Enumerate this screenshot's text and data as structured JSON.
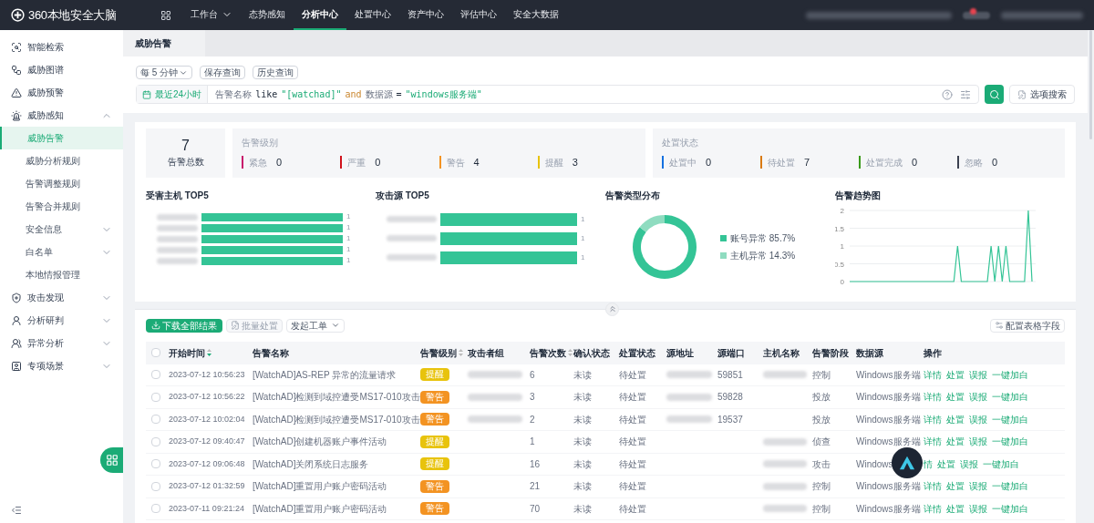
{
  "topbar": {
    "logo": "360本地安全大脑",
    "menu": [
      {
        "label": "工作台",
        "kind": "dropdown",
        "selected": false
      },
      {
        "label": "态势感知",
        "kind": "link",
        "selected": false
      },
      {
        "label": "分析中心",
        "kind": "link",
        "selected": true
      },
      {
        "label": "处置中心",
        "kind": "link",
        "selected": false
      },
      {
        "label": "资产中心",
        "kind": "link",
        "selected": false
      },
      {
        "label": "评估中心",
        "kind": "link",
        "selected": false
      },
      {
        "label": "安全大数据",
        "kind": "link",
        "selected": false
      }
    ]
  },
  "sidebar": {
    "items": [
      {
        "label": "智能检索",
        "selected": false
      },
      {
        "label": "威胁图谱",
        "selected": false
      },
      {
        "label": "威胁预警",
        "selected": false
      },
      {
        "label": "威胁感知",
        "selected": false,
        "expanded": true,
        "children": [
          {
            "label": "威胁告警",
            "selected": true
          },
          {
            "label": "威胁分析规则",
            "selected": false
          },
          {
            "label": "告警调整规则",
            "selected": false
          },
          {
            "label": "告警合并规则",
            "selected": false
          },
          {
            "label": "安全信息",
            "selected": false,
            "expanded": false
          },
          {
            "label": "白名单",
            "selected": false,
            "expanded": false
          },
          {
            "label": "本地情报管理",
            "selected": false
          }
        ]
      },
      {
        "label": "攻击发现",
        "selected": false,
        "expanded": false
      },
      {
        "label": "分析研判",
        "selected": false,
        "expanded": false
      },
      {
        "label": "异常分析",
        "selected": false,
        "expanded": false
      },
      {
        "label": "专项场景",
        "selected": false,
        "expanded": false
      }
    ]
  },
  "page_tab": "威胁告警",
  "query": {
    "interval": "每 5 分钟",
    "buttons": [
      "保存查询",
      "历史查询"
    ],
    "time_range": "最近24小时",
    "tokens": [
      {
        "text": "告警名称",
        "kind": "field"
      },
      {
        "text": "like",
        "kind": "op"
      },
      {
        "text": "\"[watchad]\"",
        "kind": "string"
      },
      {
        "text": "and",
        "kind": "keyword"
      },
      {
        "text": "数据源",
        "kind": "field"
      },
      {
        "text": "=",
        "kind": "op"
      },
      {
        "text": "\"windows服务端\"",
        "kind": "string"
      }
    ],
    "option_search": "选项搜索"
  },
  "summary": {
    "total": "7",
    "total_label": "告警总数",
    "levels": {
      "title": "告警级别",
      "items": [
        {
          "label": "紧急",
          "count": "0",
          "color": "#c8166b"
        },
        {
          "label": "严重",
          "count": "0",
          "color": "#d0121b"
        },
        {
          "label": "警告",
          "count": "4",
          "color": "#f39322"
        },
        {
          "label": "提醒",
          "count": "3",
          "color": "#e8c30c"
        }
      ]
    },
    "statuses": {
      "title": "处置状态",
      "items": [
        {
          "label": "处置中",
          "count": "0",
          "color": "#1470e0"
        },
        {
          "label": "待处置",
          "count": "7",
          "color": "#d97a12"
        },
        {
          "label": "处置完成",
          "count": "0",
          "color": "#3a9a1a"
        },
        {
          "label": "忽略",
          "count": "0",
          "color": "#3b4150"
        }
      ]
    }
  },
  "charts": [
    {
      "title": "受害主机 TOP5",
      "kind": "bar_list",
      "bars": [
        {
          "label": "1"
        },
        {
          "label": "1"
        },
        {
          "label": "1"
        },
        {
          "label": "1"
        },
        {
          "label": "1"
        }
      ]
    },
    {
      "title": "攻击源 TOP5",
      "kind": "bar_list",
      "bars": [
        {
          "label": "1"
        },
        {
          "label": "1"
        },
        {
          "label": "1"
        }
      ]
    },
    {
      "title": "告警类型分布",
      "chart_data": {
        "type": "donut",
        "categories": [
          "账号异常",
          "主机异常"
        ],
        "values": [
          85.7,
          14.3
        ],
        "legend": "right",
        "value_labels": [
          "85.7%",
          "14.3%"
        ]
      }
    },
    {
      "title": "告警趋势图",
      "chart_data": {
        "type": "line",
        "grid": true,
        "ylim": [
          0,
          2
        ],
        "yticks": [
          0,
          {
            "value": 0.5,
            "label": "0.5"
          },
          1,
          {
            "value": 1.5,
            "label": "1.5"
          },
          2
        ],
        "series": [
          {
            "color": "#34c496",
            "values": [
              0,
              0,
              0,
              0,
              0,
              0,
              0,
              0,
              0,
              0,
              0,
              0,
              0,
              0,
              0,
              0,
              0,
              0,
              0,
              0,
              0,
              0,
              0,
              0,
              0,
              0,
              0,
              0,
              0,
              1,
              0,
              0,
              0,
              0,
              0,
              0,
              0,
              0,
              1,
              0,
              1,
              0,
              1,
              0,
              0,
              0,
              0,
              0,
              2,
              0
            ]
          }
        ]
      }
    }
  ],
  "toolbar": {
    "download": "下载全部结果",
    "batch": "批量处置",
    "ticket": "发起工单",
    "configure": "配置表格字段"
  },
  "table": {
    "all_checked": false,
    "columns": [
      {
        "label": "开始时间",
        "kind": "sorted"
      },
      {
        "label": "告警名称",
        "kind": "plain"
      },
      {
        "label": "告警级别",
        "kind": "sortable"
      },
      {
        "label": "攻击者组",
        "kind": "plain"
      },
      {
        "label": "告警次数",
        "kind": "sortable"
      },
      {
        "label": "确认状态",
        "kind": "plain"
      },
      {
        "label": "处置状态",
        "kind": "plain"
      },
      {
        "label": "源地址",
        "kind": "plain"
      },
      {
        "label": "源端口",
        "kind": "plain"
      },
      {
        "label": "主机名称",
        "kind": "plain"
      },
      {
        "label": "告警阶段",
        "kind": "plain"
      },
      {
        "label": "数据源",
        "kind": "plain"
      },
      {
        "label": "操作",
        "kind": "plain"
      }
    ],
    "rows": [
      {
        "checked": false,
        "time": "2023-07-12 10:56:23",
        "name": "[WatchAD]AS-REP 异常的流量请求",
        "severity": "提醒",
        "kind": "notice",
        "count": "6",
        "confirm": "未读",
        "status": "待处置",
        "port": "59851",
        "stage": "控制",
        "source": "Windows服务端",
        "actions": [
          "详情",
          "处置",
          "误报",
          "一键加白"
        ]
      },
      {
        "checked": false,
        "time": "2023-07-12 10:56:22",
        "name": "[WatchAD]检测到域控遭受MS17-010攻击",
        "severity": "警告",
        "kind": "warning",
        "count": "3",
        "confirm": "未读",
        "status": "待处置",
        "port": "59828",
        "stage": "投放",
        "source": "Windows服务端",
        "actions": [
          "详情",
          "处置",
          "误报",
          "一键加白"
        ]
      },
      {
        "checked": false,
        "time": "2023-07-12 10:02:04",
        "name": "[WatchAD]检测到域控遭受MS17-010攻击",
        "severity": "警告",
        "kind": "warning",
        "count": "2",
        "confirm": "未读",
        "status": "待处置",
        "port": "19537",
        "stage": "投放",
        "source": "Windows服务端",
        "actions": [
          "详情",
          "处置",
          "误报",
          "一键加白"
        ]
      },
      {
        "checked": false,
        "time": "2023-07-12 09:40:47",
        "name": "[WatchAD]创建机器账户事件活动",
        "severity": "提醒",
        "kind": "notice",
        "count": "1",
        "confirm": "未读",
        "status": "待处置",
        "stage": "侦查",
        "source": "Windows服务端",
        "actions": [
          "详情",
          "处置",
          "误报",
          "一键加白"
        ]
      },
      {
        "checked": false,
        "time": "2023-07-12 09:06:48",
        "name": "[WatchAD]关闭系统日志服务",
        "severity": "提醒",
        "kind": "notice",
        "count": "16",
        "confirm": "未读",
        "status": "待处置",
        "stage": "攻击",
        "source": "Windows",
        "actions": [
          "情",
          "处置",
          "误报",
          "一键加白"
        ]
      },
      {
        "checked": false,
        "time": "2023-07-12 01:32:59",
        "name": "[WatchAD]重置用户账户密码活动",
        "severity": "警告",
        "kind": "warning",
        "count": "21",
        "confirm": "未读",
        "status": "待处置",
        "stage": "控制",
        "source": "Windows服务端",
        "actions": [
          "详情",
          "处置",
          "误报",
          "一键加白"
        ]
      },
      {
        "checked": false,
        "time": "2023-07-11 09:21:24",
        "name": "[WatchAD]重置用户账户密码活动",
        "severity": "警告",
        "kind": "warning",
        "count": "70",
        "confirm": "未读",
        "status": "待处置",
        "stage": "控制",
        "source": "Windows服务端",
        "actions": [
          "详情",
          "处置",
          "误报",
          "一键加白"
        ]
      }
    ]
  }
}
